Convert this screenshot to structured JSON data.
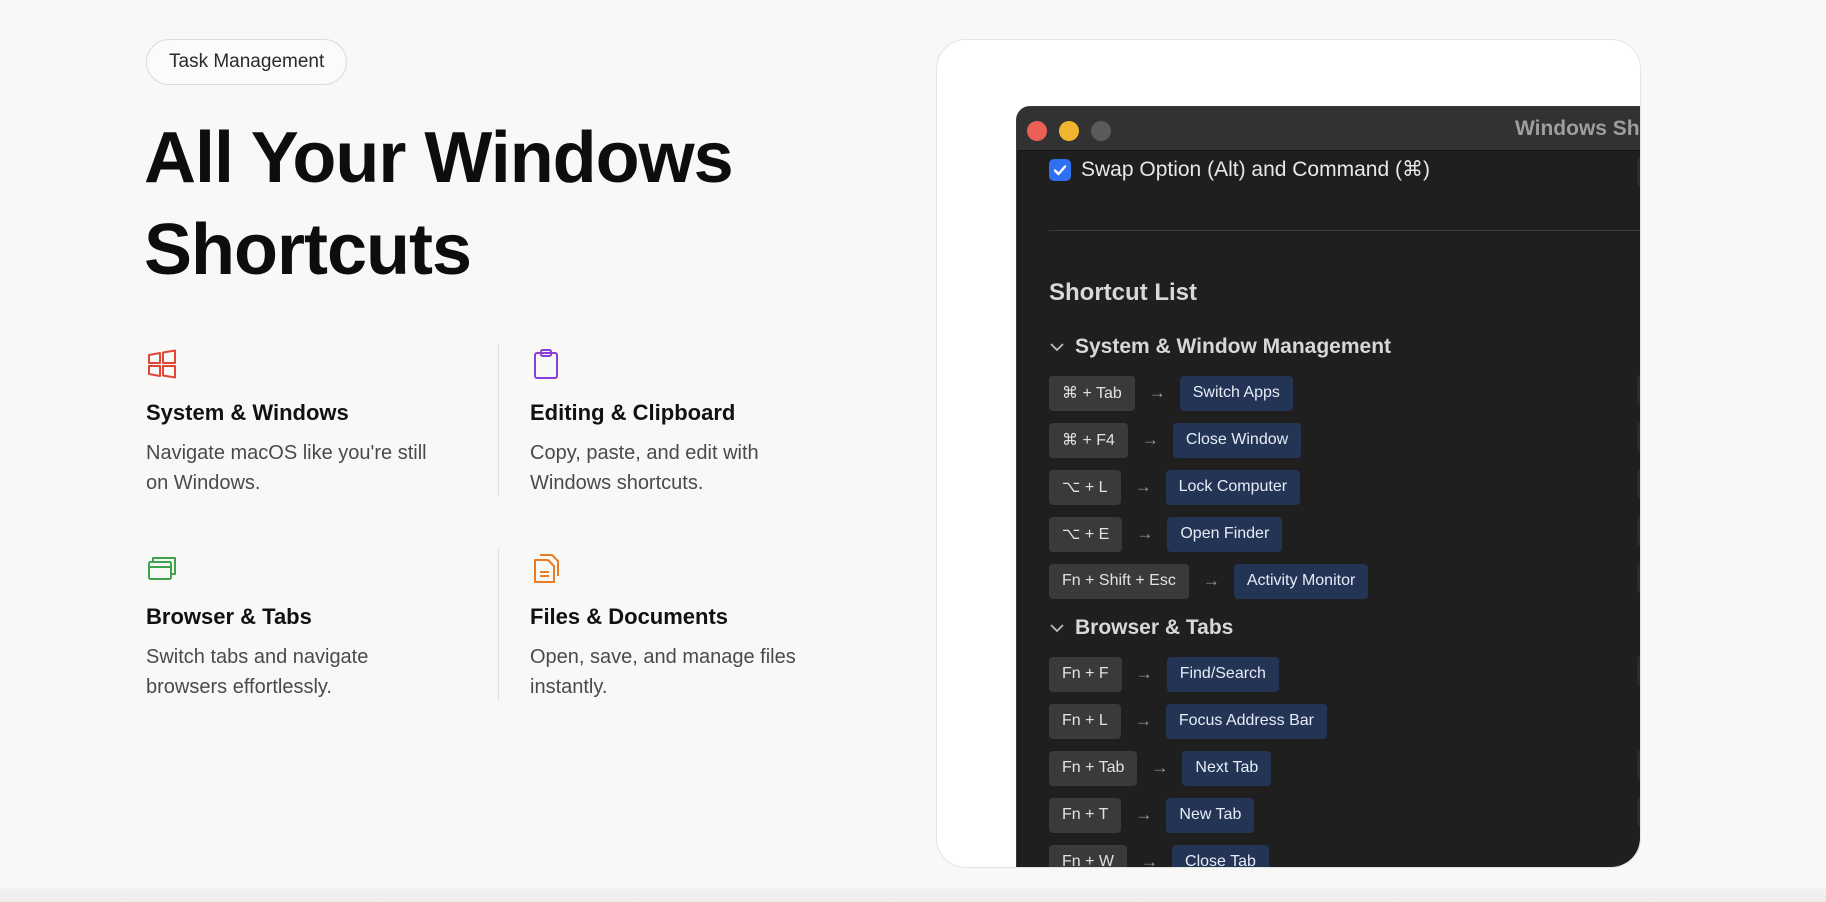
{
  "badge": "Task Management",
  "hero": {
    "line1": "All Your Windows",
    "line2": "Shortcuts"
  },
  "features": [
    {
      "icon": "windows-icon",
      "color": "#e0453a",
      "title": "System & Windows",
      "desc_line1": "Navigate macOS like you're still",
      "desc_line2": "on Windows."
    },
    {
      "icon": "clipboard-icon",
      "color": "#8b3fd9",
      "title": "Editing & Clipboard",
      "desc_line1": "Copy, paste, and edit with",
      "desc_line2": "Windows shortcuts."
    },
    {
      "icon": "browser-tabs-icon",
      "color": "#3fa34d",
      "title": "Browser & Tabs",
      "desc_line1": "Switch tabs and navigate",
      "desc_line2": "browsers effortlessly."
    },
    {
      "icon": "files-icon",
      "color": "#e97c24",
      "title": "Files & Documents",
      "desc_line1": "Open, save, and manage files",
      "desc_line2": "instantly."
    }
  ],
  "app_window": {
    "title": "Windows Sh",
    "swap_option": {
      "label": "Swap Option (Alt) and Command (⌘)",
      "checked": true
    },
    "list_title": "Shortcut List",
    "arrow_glyph": "→",
    "sections": [
      {
        "name": "System & Window Management",
        "shortcuts": [
          {
            "keys": "⌘ + Tab",
            "action": "Switch Apps"
          },
          {
            "keys": "⌘ + F4",
            "action": "Close Window"
          },
          {
            "keys": "⌥ + L",
            "action": "Lock Computer"
          },
          {
            "keys": "⌥ + E",
            "action": "Open Finder"
          },
          {
            "keys": "Fn + Shift + Esc",
            "action": "Activity Monitor"
          }
        ]
      },
      {
        "name": "Browser & Tabs",
        "shortcuts": [
          {
            "keys": "Fn + F",
            "action": "Find/Search"
          },
          {
            "keys": "Fn + L",
            "action": "Focus Address Bar"
          },
          {
            "keys": "Fn + Tab",
            "action": "Next Tab"
          },
          {
            "keys": "Fn + T",
            "action": "New Tab"
          },
          {
            "keys": "Fn + W",
            "action": "Close Tab"
          }
        ]
      }
    ]
  }
}
